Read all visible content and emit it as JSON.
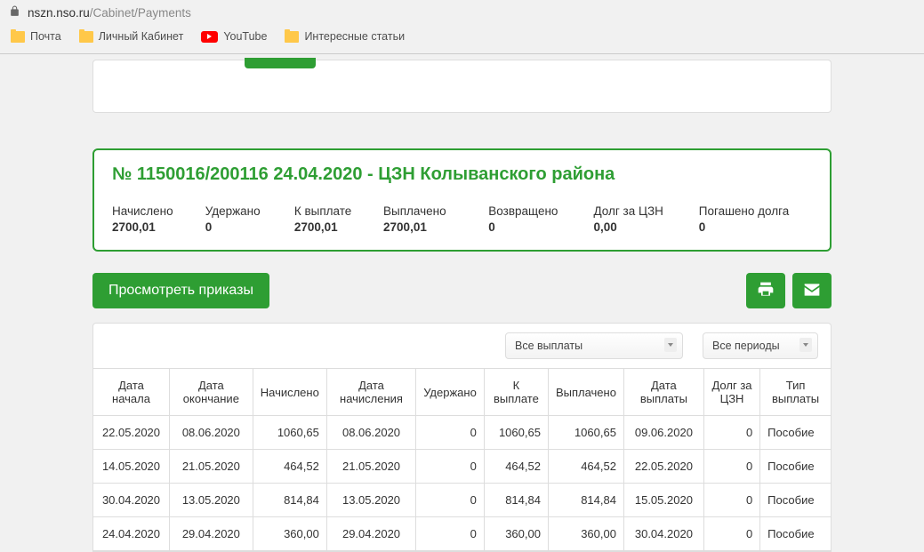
{
  "browser": {
    "url_domain": "nszn.nso.ru",
    "url_path": "/Cabinet/Payments",
    "bookmarks": [
      {
        "label": "Почта",
        "icon": "folder"
      },
      {
        "label": "Личный Кабинет",
        "icon": "folder"
      },
      {
        "label": "YouTube",
        "icon": "youtube"
      },
      {
        "label": "Интересные статьи",
        "icon": "folder"
      }
    ]
  },
  "summary": {
    "title": "№ 1150016/200116 24.04.2020 - ЦЗН Колыванского района",
    "items": [
      {
        "label": "Начислено",
        "value": "2700,01"
      },
      {
        "label": "Удержано",
        "value": "0"
      },
      {
        "label": "К выплате",
        "value": "2700,01"
      },
      {
        "label": "Выплачено",
        "value": "2700,01"
      },
      {
        "label": "Возвращено",
        "value": "0"
      },
      {
        "label": "Долг за ЦЗН",
        "value": "0,00"
      },
      {
        "label": "Погашено долга",
        "value": "0"
      }
    ]
  },
  "actions": {
    "view_orders": "Просмотреть приказы"
  },
  "filters": {
    "payments_select": "Все выплаты",
    "periods_select": "Все периоды"
  },
  "table": {
    "headers": [
      "Дата начала",
      "Дата окончание",
      "Начислено",
      "Дата начисления",
      "Удержано",
      "К выплате",
      "Выплачено",
      "Дата выплаты",
      "Долг за ЦЗН",
      "Тип выплаты"
    ],
    "rows": [
      [
        "22.05.2020",
        "08.06.2020",
        "1060,65",
        "08.06.2020",
        "0",
        "1060,65",
        "1060,65",
        "09.06.2020",
        "0",
        "Пособие"
      ],
      [
        "14.05.2020",
        "21.05.2020",
        "464,52",
        "21.05.2020",
        "0",
        "464,52",
        "464,52",
        "22.05.2020",
        "0",
        "Пособие"
      ],
      [
        "30.04.2020",
        "13.05.2020",
        "814,84",
        "13.05.2020",
        "0",
        "814,84",
        "814,84",
        "15.05.2020",
        "0",
        "Пособие"
      ],
      [
        "24.04.2020",
        "29.04.2020",
        "360,00",
        "29.04.2020",
        "0",
        "360,00",
        "360,00",
        "30.04.2020",
        "0",
        "Пособие"
      ]
    ]
  }
}
